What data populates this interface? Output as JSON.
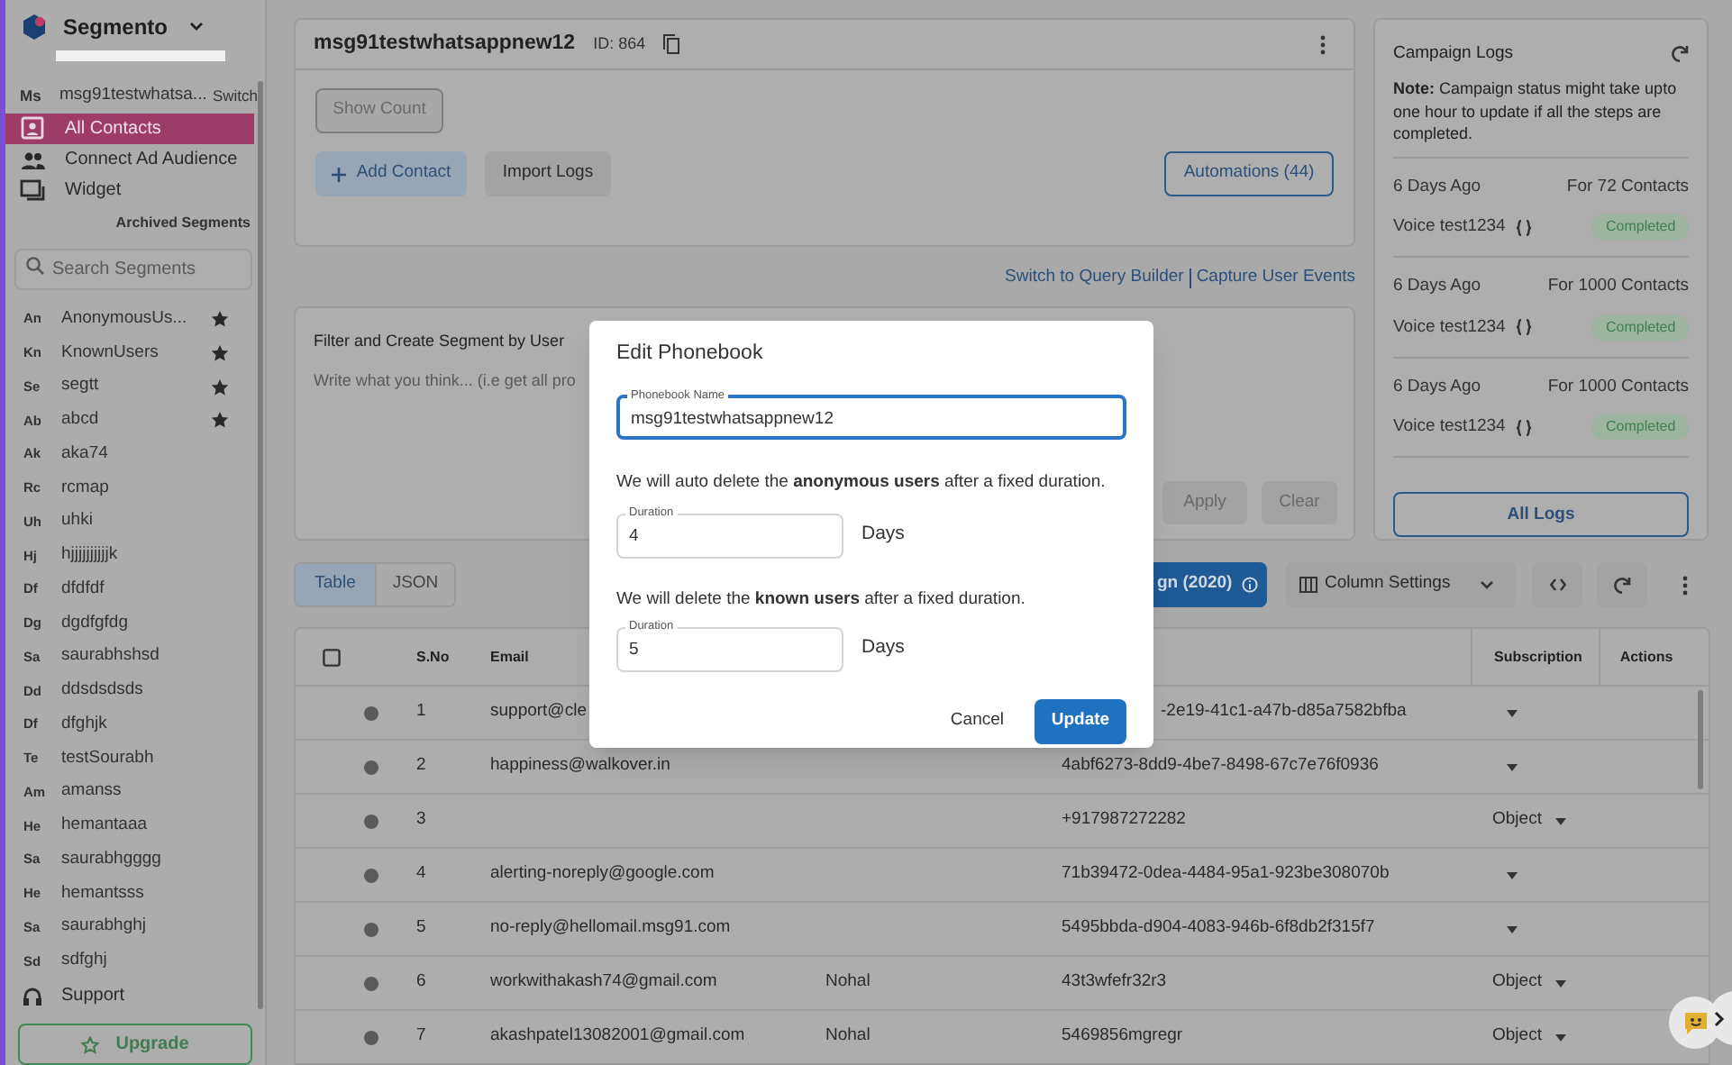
{
  "app": {
    "name": "Segmento"
  },
  "sidebar": {
    "current": {
      "initials": "Ms",
      "name": "msg91testwhatsa...",
      "action": "Switch"
    },
    "nav": [
      {
        "kind": "contacts",
        "label": "All Contacts",
        "selected": true
      },
      {
        "kind": "audience",
        "label": "Connect Ad Audience",
        "selected": false
      },
      {
        "kind": "widget",
        "label": "Widget",
        "selected": false
      }
    ],
    "archived_link": "Archived Segments",
    "search": {
      "placeholder": "Search Segments"
    },
    "segments": [
      {
        "initials": "An",
        "name": "AnonymousUs...",
        "starred": true
      },
      {
        "initials": "Kn",
        "name": "KnownUsers",
        "starred": true
      },
      {
        "initials": "Se",
        "name": "segtt",
        "starred": true
      },
      {
        "initials": "Ab",
        "name": "abcd",
        "starred": true
      },
      {
        "initials": "Ak",
        "name": "aka74",
        "starred": false
      },
      {
        "initials": "Rc",
        "name": "rcmap",
        "starred": false
      },
      {
        "initials": "Uh",
        "name": "uhki",
        "starred": false
      },
      {
        "initials": "Hj",
        "name": "hjjjjjjjjjjk",
        "starred": false
      },
      {
        "initials": "Df",
        "name": "dfdfdf",
        "starred": false
      },
      {
        "initials": "Dg",
        "name": "dgdfgfdg",
        "starred": false
      },
      {
        "initials": "Sa",
        "name": "saurabhshsd",
        "starred": false
      },
      {
        "initials": "Dd",
        "name": "ddsdsdsds",
        "starred": false
      },
      {
        "initials": "Df",
        "name": "dfghjk",
        "starred": false
      },
      {
        "initials": "Te",
        "name": "testSourabh",
        "starred": false
      },
      {
        "initials": "Am",
        "name": "amanss",
        "starred": false
      },
      {
        "initials": "He",
        "name": "hemantaaa",
        "starred": false
      },
      {
        "initials": "Sa",
        "name": "saurabhgggg",
        "starred": false
      },
      {
        "initials": "He",
        "name": "hemantsss",
        "starred": false
      },
      {
        "initials": "Sa",
        "name": "saurabhghj",
        "starred": false
      },
      {
        "initials": "Sd",
        "name": "sdfghj",
        "starred": false
      }
    ],
    "support": "Support",
    "upgrade": "Upgrade"
  },
  "phonebook": {
    "title": "msg91testwhatsappnew12",
    "id": "ID: 864",
    "show_count": "Show Count",
    "add_contact": "Add Contact",
    "import_logs": "Import Logs",
    "automations": "Automations (44)"
  },
  "links": [
    "Switch to Query Builder",
    "Capture User Events"
  ],
  "filter": {
    "title": "Filter and Create Segment by User",
    "placeholder": "Write what you think... (i.e get all pro",
    "apply": "Apply",
    "clear": "Clear"
  },
  "campaign_logs": {
    "title": "Campaign Logs",
    "note_label": "Note:",
    "note": "Campaign status might take upto one hour to update if all the steps are completed.",
    "entries": [
      {
        "when": "6 Days Ago",
        "contacts": "For 72 Contacts",
        "name": "Voice test1234",
        "status": "Completed"
      },
      {
        "when": "6 Days Ago",
        "contacts": "For 1000 Contacts",
        "name": "Voice test1234",
        "status": "Completed"
      },
      {
        "when": "6 Days Ago",
        "contacts": "For 1000 Contacts",
        "name": "Voice test1234",
        "status": "Completed"
      }
    ],
    "all_logs": "All Logs"
  },
  "toolbar": {
    "views": [
      {
        "label": "Table",
        "selected": true
      },
      {
        "label": "JSON",
        "selected": false
      }
    ],
    "segment_button": "gn (2020)",
    "column_settings": "Column Settings"
  },
  "table": {
    "select_all_checked": false,
    "columns": {
      "sno": "S.No",
      "email": "Email",
      "subscription": "Subscription",
      "actions": "Actions"
    },
    "rows": [
      {
        "sno": "1",
        "email": "support@cle",
        "id": "-2e19-41c1-a47b-d85a7582bfba"
      },
      {
        "sno": "2",
        "email": "happiness@walkover.in",
        "id": "4abf6273-8dd9-4be7-8498-67c7e76f0936"
      },
      {
        "sno": "3",
        "id": "+917987272282",
        "subscription": "Object"
      },
      {
        "sno": "4",
        "email": "alerting-noreply@google.com",
        "id": "71b39472-0dea-4484-95a1-923be308070b"
      },
      {
        "sno": "5",
        "email": "no-reply@hellomail.msg91.com",
        "id": "5495bbda-d904-4083-946b-6f8db2f315f7"
      },
      {
        "sno": "6",
        "email": "workwithakash74@gmail.com",
        "name": "Nohal",
        "id": "43t3wfefr32r3",
        "subscription": "Object"
      },
      {
        "sno": "7",
        "email": "akashpatel13082001@gmail.com",
        "name": "Nohal",
        "id": "5469856mgregr",
        "subscription": "Object"
      }
    ]
  },
  "dialog": {
    "title": "Edit Phonebook",
    "name_label": "Phonebook Name",
    "name_value": "msg91testwhatsappnew12",
    "anonymous_text": "We will auto delete the **anonymous users** after a fixed duration.",
    "duration_label_1": "Duration",
    "duration_1": "4",
    "unit_1": "Days",
    "known_text": "We will delete the **known users** after a fixed duration.",
    "duration_label_2": "Duration",
    "duration_2": "5",
    "unit_2": "Days",
    "cancel": "Cancel",
    "update": "Update"
  }
}
